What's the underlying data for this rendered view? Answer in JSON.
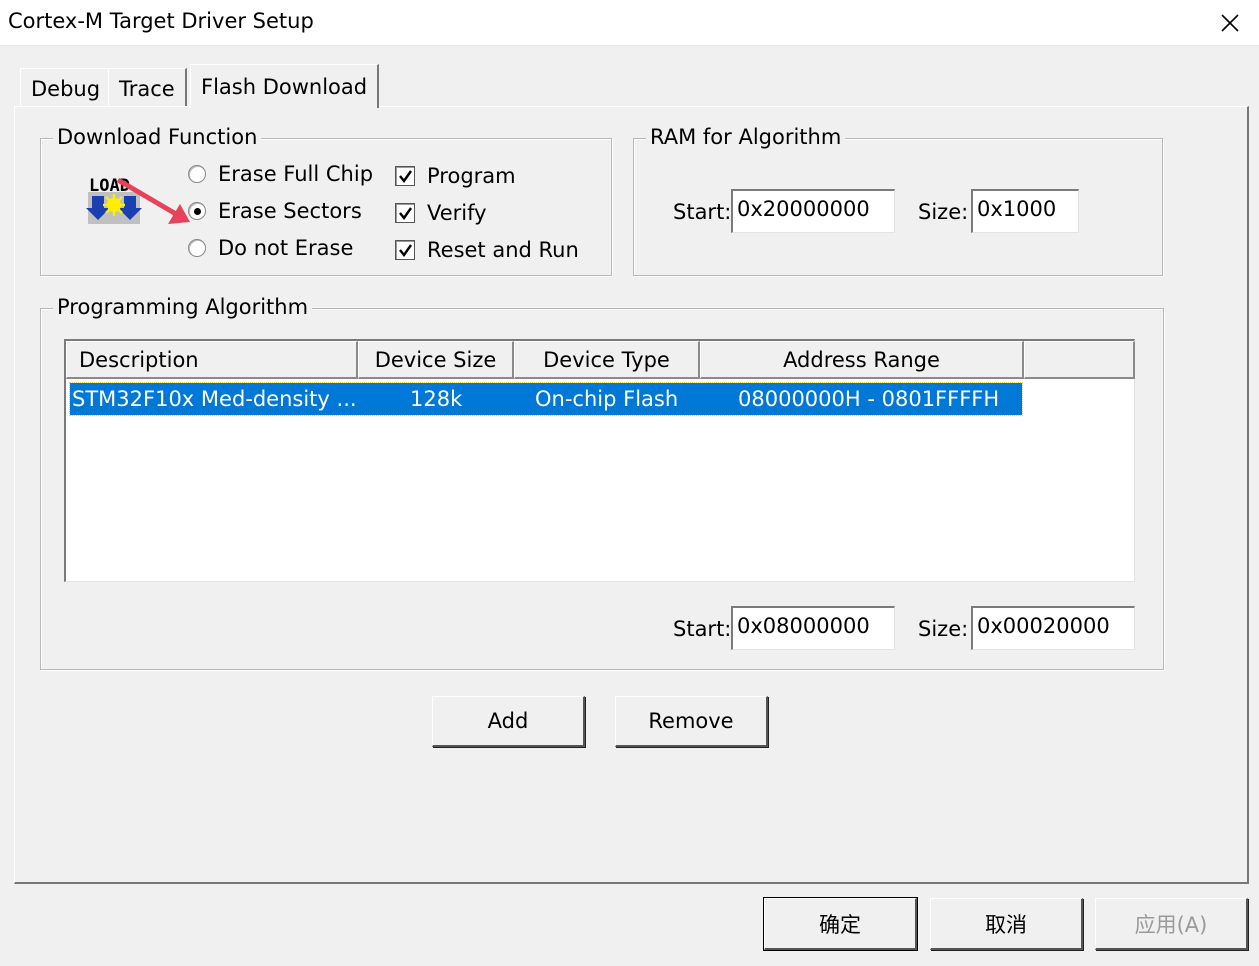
{
  "window": {
    "title": "Cortex-M Target Driver Setup",
    "close_glyph": "✕"
  },
  "tabs": [
    {
      "label": "Debug",
      "active": false
    },
    {
      "label": "Trace",
      "active": false
    },
    {
      "label": "Flash Download",
      "active": true
    }
  ],
  "download_function": {
    "label": "Download Function",
    "icon": "load-icon",
    "icon_text": "LOAD",
    "erase_options": [
      {
        "label": "Erase Full Chip",
        "selected": false
      },
      {
        "label": "Erase Sectors",
        "selected": true
      },
      {
        "label": "Do not Erase",
        "selected": false
      }
    ],
    "checks": [
      {
        "label": "Program",
        "checked": true
      },
      {
        "label": "Verify",
        "checked": true
      },
      {
        "label": "Reset and Run",
        "checked": true
      }
    ]
  },
  "ram": {
    "label": "RAM for Algorithm",
    "start_label": "Start:",
    "start_value": "0x20000000",
    "size_label": "Size:",
    "size_value": "0x1000"
  },
  "programming": {
    "label": "Programming Algorithm",
    "columns": [
      "Description",
      "Device Size",
      "Device Type",
      "Address Range"
    ],
    "rows": [
      {
        "description": "STM32F10x Med-density ...",
        "device_size": "128k",
        "device_type": "On-chip Flash",
        "address_range": "08000000H - 0801FFFFH",
        "selected": true
      }
    ],
    "start_label": "Start:",
    "start_value": "0x08000000",
    "size_label": "Size:",
    "size_value": "0x00020000"
  },
  "actions": {
    "add": "Add",
    "remove": "Remove"
  },
  "footer": {
    "ok": "确定",
    "cancel": "取消",
    "apply": "应用(A)",
    "apply_enabled": false
  },
  "colors": {
    "selection": "#0078d7",
    "annotation_arrow": "#e8425a",
    "dialog_bg": "#f0f0f0"
  }
}
